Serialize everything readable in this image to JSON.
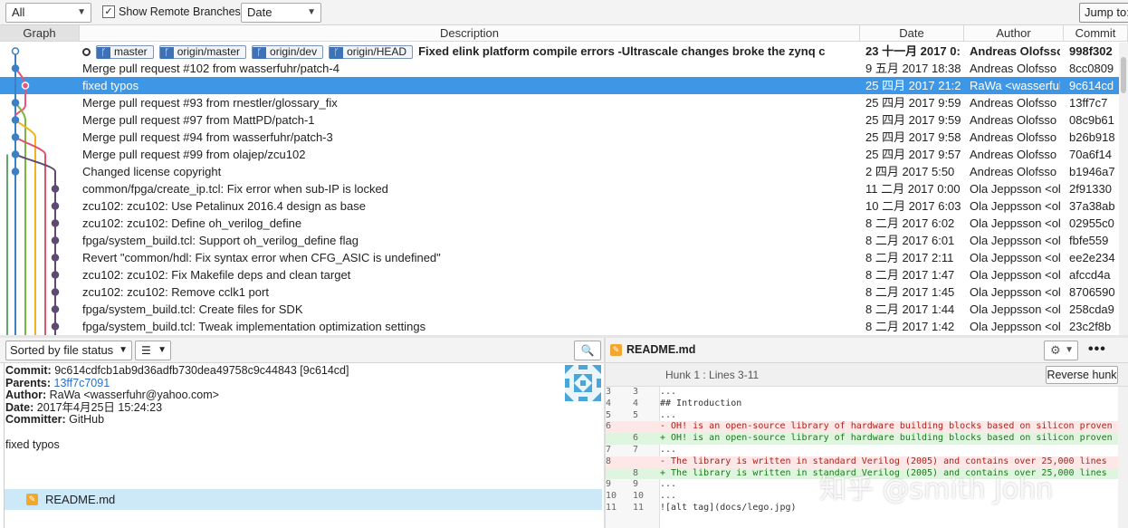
{
  "toolbar": {
    "branches": "All Branches",
    "show_remote": "Show Remote Branches",
    "show_remote_checked": "✓",
    "order": "Date Order",
    "jump": "Jump to:"
  },
  "columns": {
    "graph": "Graph",
    "description": "Description",
    "date": "Date",
    "author": "Author",
    "commit": "Commit"
  },
  "head_row": {
    "tags": [
      "master",
      "origin/master",
      "origin/dev",
      "origin/HEAD"
    ],
    "description": "Fixed elink platform compile errors -Ultrascale changes broke the zynq c",
    "date": "23 十一月 2017 0:",
    "author": "Andreas Olofsso",
    "commit": "998f302"
  },
  "commits": [
    {
      "description": "Merge pull request #102 from wasserfuhr/patch-4",
      "date": "9 五月 2017 18:38",
      "author": "Andreas Olofsso",
      "commit": "8cc0809"
    },
    {
      "description": "fixed typos",
      "date": "25 四月 2017 21:2",
      "author": "RaWa <wasserful",
      "commit": "9c614cd"
    },
    {
      "description": "Merge pull request #93 from rnestler/glossary_fix",
      "date": "25 四月 2017 9:59",
      "author": "Andreas Olofsso",
      "commit": "13ff7c7"
    },
    {
      "description": "Merge pull request #97 from MattPD/patch-1",
      "date": "25 四月 2017 9:59",
      "author": "Andreas Olofsso",
      "commit": "08c9b61"
    },
    {
      "description": "Merge pull request #94 from wasserfuhr/patch-3",
      "date": "25 四月 2017 9:58",
      "author": "Andreas Olofsso",
      "commit": "b26b918"
    },
    {
      "description": "Merge pull request #99 from olajep/zcu102",
      "date": "25 四月 2017 9:57",
      "author": "Andreas Olofsso",
      "commit": "70a6f14"
    },
    {
      "description": "Changed license copyright",
      "date": "2 四月 2017 5:50",
      "author": "Andreas Olofsso",
      "commit": "b1946a7"
    },
    {
      "description": "common/fpga/create_ip.tcl: Fix error when sub-IP is locked",
      "date": "11 二月 2017 0:00",
      "author": "Ola Jeppsson <ol",
      "commit": "2f91330"
    },
    {
      "description": "zcu102: zcu102: Use Petalinux 2016.4 design as base",
      "date": "10 二月 2017 6:03",
      "author": "Ola Jeppsson <ol",
      "commit": "37a38ab"
    },
    {
      "description": "zcu102: zcu102: Define oh_verilog_define",
      "date": "8 二月 2017 6:02",
      "author": "Ola Jeppsson <ol",
      "commit": "02955c0"
    },
    {
      "description": "fpga/system_build.tcl: Support oh_verilog_define flag",
      "date": "8 二月 2017 6:01",
      "author": "Ola Jeppsson <ol",
      "commit": "fbfe559"
    },
    {
      "description": "Revert \"common/hdl: Fix syntax error when CFG_ASIC is undefined\"",
      "date": "8 二月 2017 2:11",
      "author": "Ola Jeppsson <ol",
      "commit": "ee2e234"
    },
    {
      "description": "zcu102: zcu102: Fix Makefile deps and clean target",
      "date": "8 二月 2017 1:47",
      "author": "Ola Jeppsson <ol",
      "commit": "afccd4a"
    },
    {
      "description": "zcu102: zcu102: Remove cclk1 port",
      "date": "8 二月 2017 1:45",
      "author": "Ola Jeppsson <ol",
      "commit": "8706590"
    },
    {
      "description": "fpga/system_build.tcl: Create files for SDK",
      "date": "8 二月 2017 1:44",
      "author": "Ola Jeppsson <ol",
      "commit": "258cda9"
    },
    {
      "description": "fpga/system_build.tcl: Tweak implementation optimization settings",
      "date": "8 二月 2017 1:42",
      "author": "Ola Jeppsson <ol",
      "commit": "23c2f8b"
    }
  ],
  "bottom_left": {
    "sort": "Sorted by file status",
    "list_icon": "☰",
    "search_icon": "🔍",
    "commit_label": "Commit:",
    "commit_value": "9c614cdfcb1ab9d36adfb730dea49758c9c44843 [9c614cd]",
    "parents_label": "Parents:",
    "parents_value": "13ff7c7091",
    "author_label": "Author:",
    "author_value": "RaWa <wasserfuhr@yahoo.com>",
    "date_label": "Date:",
    "date_value": "2017年4月25日 15:24:23",
    "committer_label": "Committer:",
    "committer_value": "GitHub",
    "message": "fixed typos",
    "file": "README.md"
  },
  "bottom_right": {
    "file": "README.md",
    "gear": "⚙",
    "more": "•••",
    "hunk_title": "Hunk 1 : Lines 3-11",
    "reverse_hunk": "Reverse hunk",
    "watermark": "知乎 @smith John"
  },
  "diff_lines": [
    {
      "o": "3",
      "n": "3",
      "t": "...",
      "kind": "ctx"
    },
    {
      "o": "4",
      "n": "4",
      "t": "## Introduction",
      "kind": "ctx"
    },
    {
      "o": "5",
      "n": "5",
      "t": "...",
      "kind": "ctx"
    },
    {
      "o": "6",
      "n": "",
      "t": "- OH! is an open-source library of hardware building blocks based on silicon proven",
      "kind": "del"
    },
    {
      "o": "",
      "n": "6",
      "t": "+ OH! is an open-source library of hardware building blocks based on silicon proven",
      "kind": "add"
    },
    {
      "o": "7",
      "n": "7",
      "t": "...",
      "kind": "ctx"
    },
    {
      "o": "8",
      "n": "",
      "t": "- The library is written in standard Verilog (2005) and contains over 25,000 lines",
      "kind": "del"
    },
    {
      "o": "",
      "n": "8",
      "t": "+ The library is written in standard Verilog (2005) and contains over 25,000 lines",
      "kind": "add"
    },
    {
      "o": "9",
      "n": "9",
      "t": "...",
      "kind": "ctx"
    },
    {
      "o": "10",
      "n": "10",
      "t": "...",
      "kind": "ctx"
    },
    {
      "o": "11",
      "n": "11",
      "t": "![alt tag](docs/lego.jpg)",
      "kind": "ctx"
    }
  ]
}
